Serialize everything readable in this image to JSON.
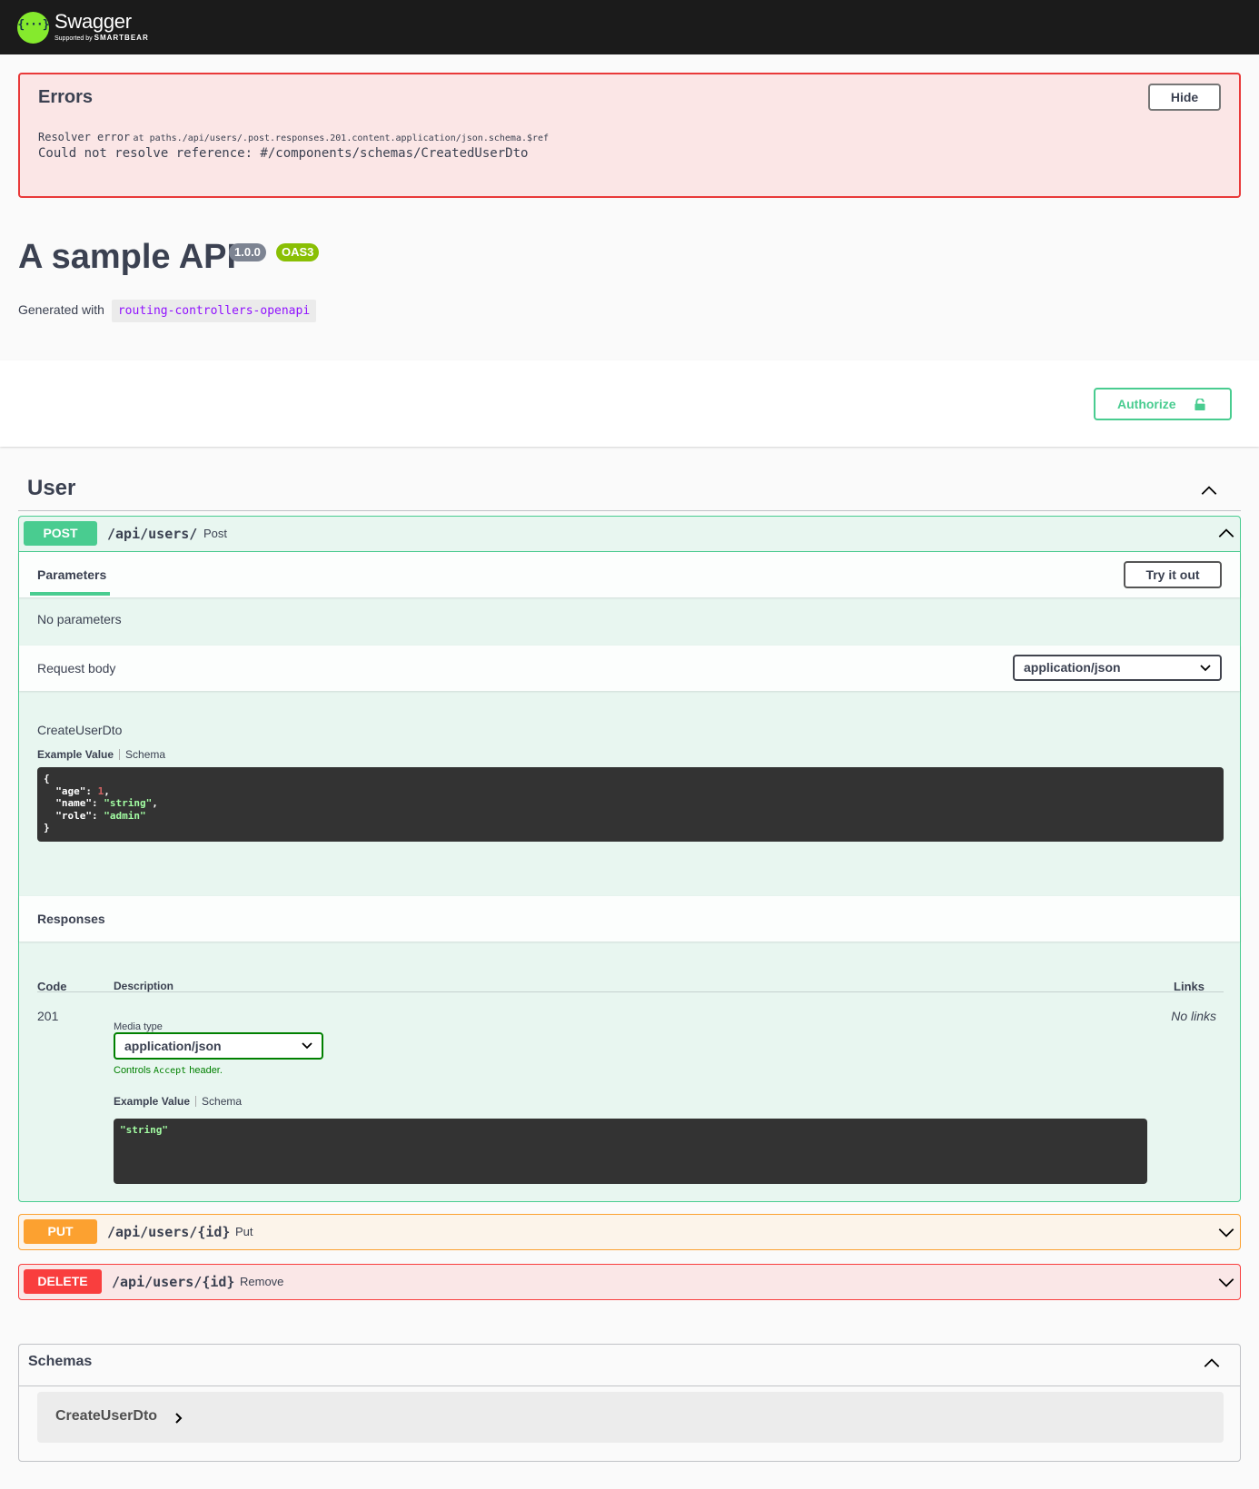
{
  "topbar": {
    "logo_name": "Swagger",
    "logo_sub_prefix": "Supported by",
    "logo_sub_brand": "SMARTBEAR",
    "logo_glyph": "{···}"
  },
  "errors": {
    "title": "Errors",
    "hide_label": "Hide",
    "resolver_label": "Resolver error",
    "at_text": "at",
    "path": "paths./api/users/.post.responses.201.content.application/json.schema.$ref",
    "message": "Could not resolve reference: #/components/schemas/CreatedUserDto"
  },
  "info": {
    "title": "A sample API",
    "version": "1.0.0",
    "oas_badge": "OAS3",
    "description_prefix": "Generated with",
    "description_code": "routing-controllers-openapi"
  },
  "authorize": {
    "label": "Authorize",
    "icon": "lock-icon"
  },
  "tag": {
    "name": "User"
  },
  "post_op": {
    "method": "POST",
    "path": "/api/users/",
    "summary": "Post",
    "parameters_tab": "Parameters",
    "try_label": "Try it out",
    "no_params": "No parameters",
    "request_body_label": "Request body",
    "request_content_type": "application/json",
    "model_name": "CreateUserDto",
    "example_tab": "Example Value",
    "schema_tab": "Schema",
    "example_lines": {
      "open": "{",
      "age_key": "\"age\"",
      "age_val": "1",
      "name_key": "\"name\"",
      "name_val": "\"string\"",
      "role_key": "\"role\"",
      "role_val": "\"admin\"",
      "close": "}"
    },
    "responses_label": "Responses",
    "columns": {
      "code": "Code",
      "description": "Description",
      "links": "Links"
    },
    "response": {
      "code": "201",
      "media_type_label": "Media type",
      "media_type": "application/json",
      "controls_prefix": "Controls",
      "controls_code": "Accept",
      "controls_suffix": "header.",
      "example_tab": "Example Value",
      "schema_tab": "Schema",
      "example": "\"string\"",
      "links": "No links"
    }
  },
  "put_op": {
    "method": "PUT",
    "path": "/api/users/{id}",
    "summary": "Put"
  },
  "delete_op": {
    "method": "DELETE",
    "path": "/api/users/{id}",
    "summary": "Remove"
  },
  "schemas": {
    "title": "Schemas",
    "models": [
      "CreateUserDto"
    ]
  },
  "colors": {
    "post": "#49cc90",
    "put": "#fca130",
    "delete": "#f93e3e",
    "error": "#e93939",
    "topbar": "#1b1b1b"
  }
}
